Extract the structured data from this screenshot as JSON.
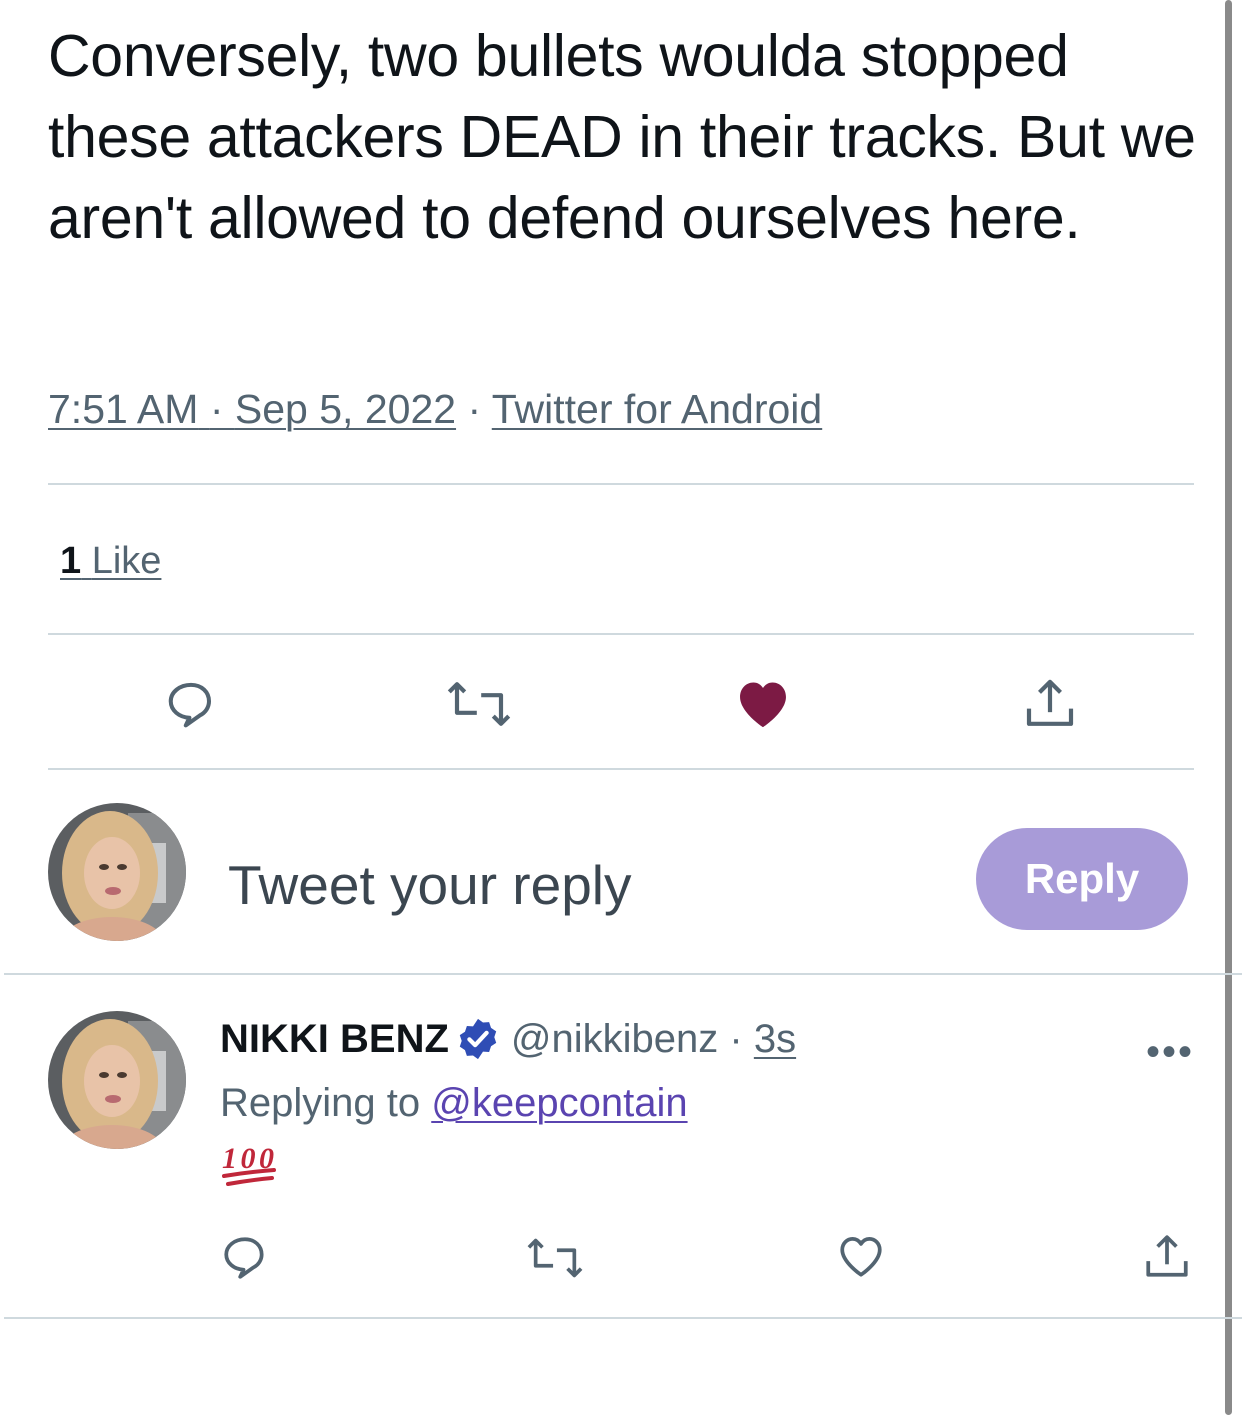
{
  "tweet": {
    "text": "Conversely, two bullets woulda stopped these attackers DEAD in their tracks. But we aren't allowed to defend ourselves here.",
    "time": "7:51 AM",
    "date": "Sep 5, 2022",
    "separator": "·",
    "source": "Twitter for Android"
  },
  "stats": {
    "like_count": "1",
    "like_label": "Like"
  },
  "actions": {
    "reply_icon": "comment-icon",
    "retweet_icon": "retweet-icon",
    "like_icon": "heart-filled-icon",
    "share_icon": "share-icon",
    "like_color": "#7c1a44"
  },
  "composer": {
    "placeholder": "Tweet your reply",
    "button_label": "Reply",
    "button_color": "#a89bd8"
  },
  "reply": {
    "author_name": "NIKKI BENZ",
    "handle": "@nikkibenz",
    "separator": "·",
    "time": "3s",
    "replying_prefix": "Replying to",
    "replying_to": "@keepcontain",
    "content_emoji": "hundred-points-emoji",
    "more_label": "•••",
    "mention_color": "#5a44b0"
  }
}
